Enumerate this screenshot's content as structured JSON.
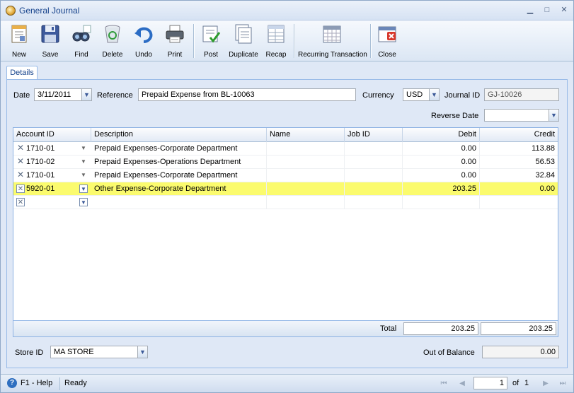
{
  "window": {
    "title": "General Journal",
    "controls": [
      "minimize",
      "maximize",
      "close"
    ]
  },
  "toolbar": {
    "new_label": "New",
    "save_label": "Save",
    "find_label": "Find",
    "delete_label": "Delete",
    "undo_label": "Undo",
    "print_label": "Print",
    "post_label": "Post",
    "duplicate_label": "Duplicate",
    "recap_label": "Recap",
    "recurring_label": "Recurring Transaction",
    "close_label": "Close"
  },
  "tabs": {
    "details": "Details"
  },
  "form": {
    "date_label": "Date",
    "date_value": "3/11/2011",
    "reference_label": "Reference",
    "reference_value": "Prepaid Expense from BL-10063",
    "currency_label": "Currency",
    "currency_value": "USD",
    "journal_id_label": "Journal ID",
    "journal_id_value": "GJ-10026",
    "reverse_date_label": "Reverse Date",
    "reverse_date_value": ""
  },
  "grid": {
    "columns": {
      "account_id": "Account ID",
      "description": "Description",
      "name": "Name",
      "job_id": "Job ID",
      "debit": "Debit",
      "credit": "Credit"
    },
    "rows": [
      {
        "account_id": "1710-01",
        "description": "Prepaid Expenses-Corporate Department",
        "name": "",
        "job_id": "",
        "debit": "0.00",
        "credit": "113.88"
      },
      {
        "account_id": "1710-02",
        "description": "Prepaid Expenses-Operations Department",
        "name": "",
        "job_id": "",
        "debit": "0.00",
        "credit": "56.53"
      },
      {
        "account_id": "1710-01",
        "description": "Prepaid Expenses-Corporate Department",
        "name": "",
        "job_id": "",
        "debit": "0.00",
        "credit": "32.84"
      },
      {
        "account_id": "5920-01",
        "description": "Other Expense-Corporate Department",
        "name": "",
        "job_id": "",
        "debit": "203.25",
        "credit": "0.00"
      },
      {
        "account_id": "",
        "description": "",
        "name": "",
        "job_id": "",
        "debit": "",
        "credit": ""
      }
    ],
    "selected_row": 3,
    "total_label": "Total",
    "total_debit": "203.25",
    "total_credit": "203.25"
  },
  "bottom": {
    "store_id_label": "Store ID",
    "store_id_value": "MA STORE",
    "out_of_balance_label": "Out of Balance",
    "out_of_balance_value": "0.00"
  },
  "status": {
    "help_text": "F1 - Help",
    "state_text": "Ready",
    "page_current": "1",
    "page_of_label": "of",
    "page_total": "1"
  },
  "colors": {
    "selected_row": "#fbfb6e",
    "title_text": "#15428b",
    "background": "#dfe8f6"
  }
}
